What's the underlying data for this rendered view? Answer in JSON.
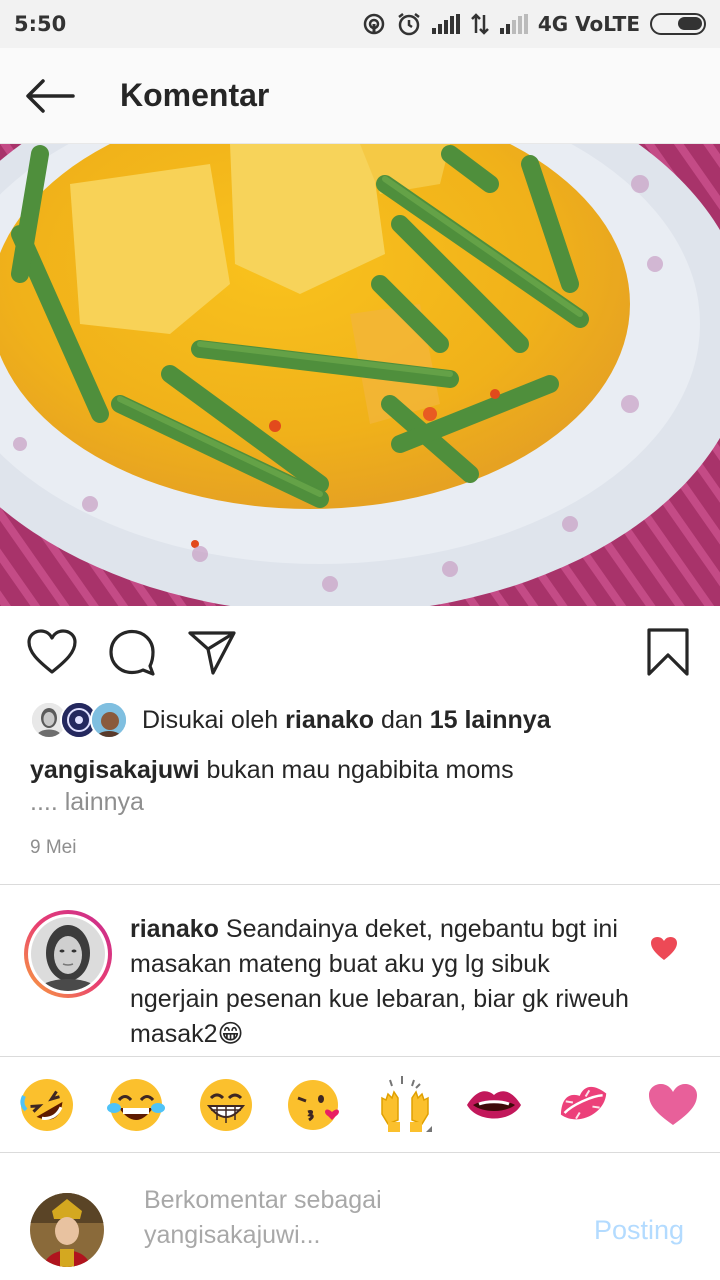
{
  "status_bar": {
    "time": "5:50",
    "network": "4G VoLTE",
    "icons": [
      "hotspot-icon",
      "alarm-icon",
      "signal-icon",
      "data-arrows-icon",
      "signal-weak-icon",
      "battery-icon"
    ]
  },
  "header": {
    "title": "Komentar",
    "back_icon": "arrow-left-icon"
  },
  "post": {
    "image_icon": "food-photo",
    "actions": [
      "heart-icon",
      "comment-icon",
      "share-icon",
      "bookmark-icon"
    ],
    "likes": {
      "prefix": "Disukai oleh",
      "user": "rianako",
      "joiner": "dan",
      "others": "15 lainnya"
    },
    "caption": {
      "user": "yangisakajuwi",
      "text": "bukan mau ngabibita moms",
      "more": ".... lainnya"
    },
    "date": "9 Mei"
  },
  "comment": {
    "user": "rianako",
    "text": "Seandainya deket, ngebantu bgt ini masakan mateng buat aku yg lg sibuk ngerjain pesenan kue lebaran, biar gk riweuh masak2😁",
    "liked": true,
    "heart_color": "#ed4956"
  },
  "emoji_bar": {
    "items": [
      "🤣",
      "😂",
      "😁",
      "😘",
      "🙌",
      "👄",
      "💋",
      "💖"
    ]
  },
  "composer": {
    "placeholder": "Berkomentar sebagai yangisakajuwi...",
    "post_label": "Posting"
  },
  "colors": {
    "post_button_disabled": "#b3dbff",
    "muted_text": "#8e8e8e",
    "story_ring": "#e83e72"
  }
}
